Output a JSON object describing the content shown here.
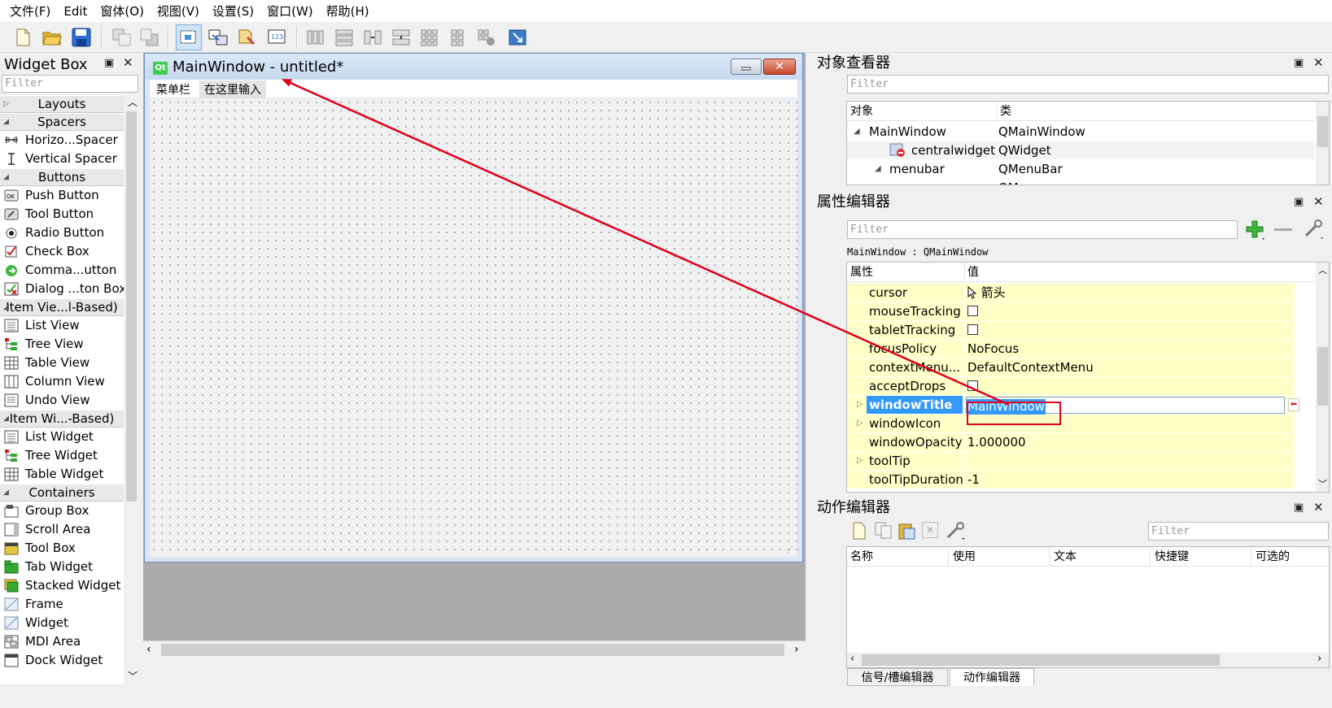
{
  "menu": [
    "文件(F)",
    "Edit",
    "窗体(O)",
    "视图(V)",
    "设置(S)",
    "窗口(W)",
    "帮助(H)"
  ],
  "toolbar_icons": [
    "new-file-icon",
    "open-folder-icon",
    "save-icon",
    "send-to-back-icon",
    "bring-to-front-icon",
    "edit-widgets-icon",
    "edit-signals-slots-icon",
    "edit-buddies-icon",
    "edit-tab-order-icon",
    "lay-out-horizontally-icon",
    "lay-out-vertically-icon",
    "lay-out-horizontal-splitter-icon",
    "lay-out-vertical-splitter-icon",
    "lay-out-grid-icon",
    "lay-out-form-icon",
    "break-layout-icon",
    "adjust-size-icon"
  ],
  "widget_box": {
    "title": "Widget Box",
    "filter_placeholder": "Filter",
    "entries": [
      {
        "kind": "cat",
        "label": "Layouts",
        "collapsed": true
      },
      {
        "kind": "cat",
        "label": "Spacers"
      },
      {
        "kind": "item",
        "label": "Horizo...Spacer",
        "icon": "horizontal-spacer-icon"
      },
      {
        "kind": "item",
        "label": "Vertical Spacer",
        "icon": "vertical-spacer-icon"
      },
      {
        "kind": "cat",
        "label": "Buttons"
      },
      {
        "kind": "item",
        "label": "Push Button",
        "icon": "push-button-icon"
      },
      {
        "kind": "item",
        "label": "Tool Button",
        "icon": "tool-button-icon"
      },
      {
        "kind": "item",
        "label": "Radio Button",
        "icon": "radio-button-icon"
      },
      {
        "kind": "item",
        "label": "Check Box",
        "icon": "check-box-icon"
      },
      {
        "kind": "item",
        "label": "Comma...utton",
        "icon": "command-link-button-icon"
      },
      {
        "kind": "item",
        "label": "Dialog ...ton Box",
        "icon": "dialog-button-box-icon"
      },
      {
        "kind": "cat",
        "label": "Item Vie...l-Based)"
      },
      {
        "kind": "item",
        "label": "List View",
        "icon": "list-view-icon"
      },
      {
        "kind": "item",
        "label": "Tree View",
        "icon": "tree-view-icon"
      },
      {
        "kind": "item",
        "label": "Table View",
        "icon": "table-view-icon"
      },
      {
        "kind": "item",
        "label": "Column View",
        "icon": "column-view-icon"
      },
      {
        "kind": "item",
        "label": "Undo View",
        "icon": "undo-view-icon"
      },
      {
        "kind": "cat",
        "label": "Item Wi...-Based)"
      },
      {
        "kind": "item",
        "label": "List Widget",
        "icon": "list-widget-icon"
      },
      {
        "kind": "item",
        "label": "Tree Widget",
        "icon": "tree-widget-icon"
      },
      {
        "kind": "item",
        "label": "Table Widget",
        "icon": "table-widget-icon"
      },
      {
        "kind": "cat",
        "label": "Containers"
      },
      {
        "kind": "item",
        "label": "Group Box",
        "icon": "group-box-icon"
      },
      {
        "kind": "item",
        "label": "Scroll Area",
        "icon": "scroll-area-icon"
      },
      {
        "kind": "item",
        "label": "Tool Box",
        "icon": "tool-box-icon"
      },
      {
        "kind": "item",
        "label": "Tab Widget",
        "icon": "tab-widget-icon"
      },
      {
        "kind": "item",
        "label": "Stacked Widget",
        "icon": "stacked-widget-icon"
      },
      {
        "kind": "item",
        "label": "Frame",
        "icon": "frame-icon"
      },
      {
        "kind": "item",
        "label": "Widget",
        "icon": "widget-icon"
      },
      {
        "kind": "item",
        "label": "MDI Area",
        "icon": "mdi-area-icon"
      },
      {
        "kind": "item",
        "label": "Dock Widget",
        "icon": "dock-widget-icon"
      }
    ]
  },
  "form": {
    "window_title": "MainWindow - untitled*",
    "menubar_label": "菜单栏",
    "type_here": "在这里输入"
  },
  "object_inspector": {
    "title": "对象查看器",
    "filter_placeholder": "Filter",
    "col_object": "对象",
    "col_class": "类",
    "rows": [
      {
        "object": "MainWindow",
        "class": "QMainWindow"
      },
      {
        "object": "centralwidget",
        "class": "QWidget"
      },
      {
        "object": "menubar",
        "class": "QMenuBar"
      },
      {
        "object": "",
        "class": "QM"
      }
    ]
  },
  "property_editor": {
    "title": "属性编辑器",
    "filter_placeholder": "Filter",
    "context": "MainWindow : QMainWindow",
    "col_property": "属性",
    "col_value": "值",
    "rows": [
      {
        "name": "cursor",
        "value": "箭头",
        "type": "cursor"
      },
      {
        "name": "mouseTracking",
        "value": "",
        "type": "checkbox"
      },
      {
        "name": "tabletTracking",
        "value": "",
        "type": "checkbox"
      },
      {
        "name": "focusPolicy",
        "value": "NoFocus",
        "type": "text"
      },
      {
        "name": "contextMenu...",
        "value": "DefaultContextMenu",
        "type": "text"
      },
      {
        "name": "acceptDrops",
        "value": "",
        "type": "checkbox"
      },
      {
        "name": "windowTitle",
        "value": "MainWindow",
        "type": "editing",
        "expandable": true
      },
      {
        "name": "windowIcon",
        "value": "",
        "type": "text",
        "expandable": true
      },
      {
        "name": "windowOpacity",
        "value": "1.000000",
        "type": "text"
      },
      {
        "name": "toolTip",
        "value": "",
        "type": "text",
        "expandable": true
      },
      {
        "name": "toolTipDuration",
        "value": "-1",
        "type": "text"
      }
    ]
  },
  "action_editor": {
    "title": "动作编辑器",
    "filter_placeholder": "Filter",
    "columns": [
      "名称",
      "使用",
      "文本",
      "快捷键",
      "可选的"
    ]
  },
  "bottom_tabs": [
    {
      "label": "信号/槽编辑器",
      "selected": false
    },
    {
      "label": "动作编辑器",
      "selected": true
    }
  ],
  "colors": {
    "annotation_red": "#e0001b",
    "property_row_bg": "#ffffc8",
    "selection_blue": "#3399ff"
  }
}
